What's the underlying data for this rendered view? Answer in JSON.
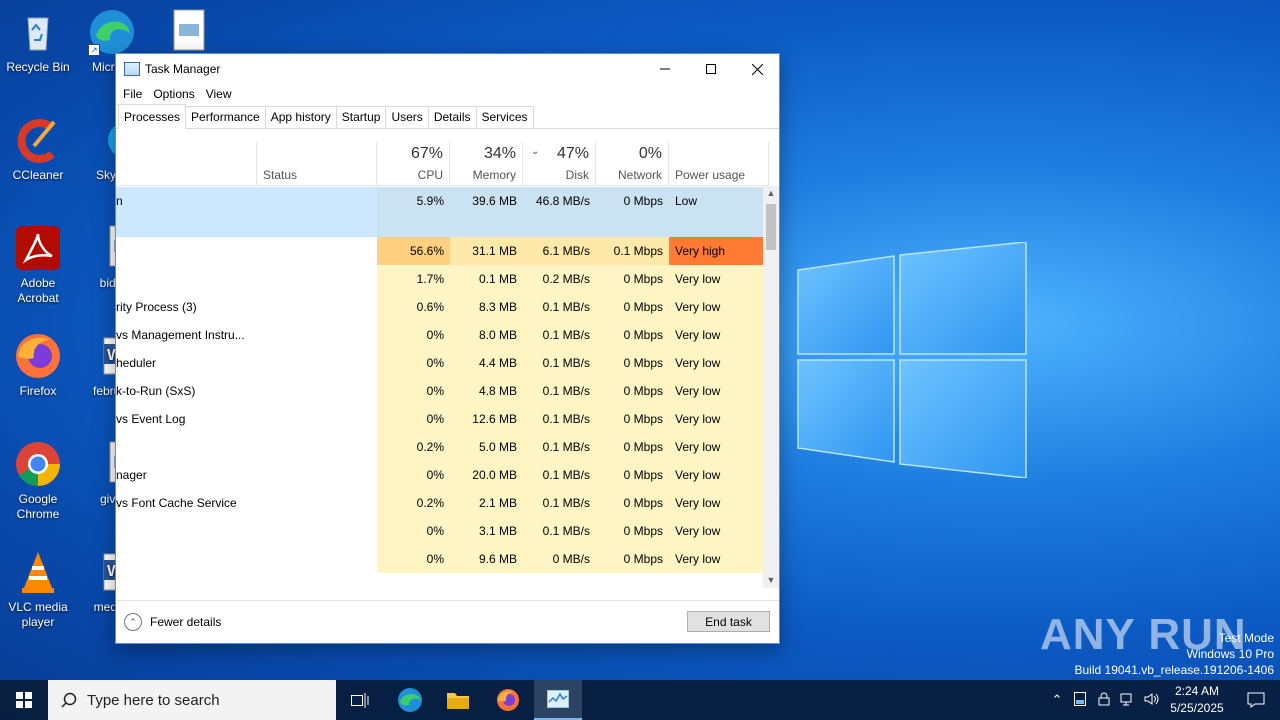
{
  "desktop": {
    "icons": [
      {
        "label": "Recycle Bin"
      },
      {
        "label": "Microsoft Edge"
      },
      {
        "label": "CCleaner"
      },
      {
        "label": "Skype"
      },
      {
        "label": "Adobe Acrobat"
      },
      {
        "label": "bidex"
      },
      {
        "label": "Firefox"
      },
      {
        "label": "februar"
      },
      {
        "label": "Google Chrome"
      },
      {
        "label": "givec"
      },
      {
        "label": "VLC media player"
      },
      {
        "label": "medire"
      }
    ]
  },
  "window": {
    "title": "Task Manager",
    "menu": [
      "File",
      "Options",
      "View"
    ],
    "tabs": [
      "Processes",
      "Performance",
      "App history",
      "Startup",
      "Users",
      "Details",
      "Services"
    ],
    "active_tab": "Processes"
  },
  "columns": {
    "status": {
      "label": "Status"
    },
    "cpu": {
      "pct": "67%",
      "label": "CPU"
    },
    "memory": {
      "pct": "34%",
      "label": "Memory"
    },
    "disk": {
      "pct": "47%",
      "label": "Disk"
    },
    "network": {
      "pct": "0%",
      "label": "Network"
    },
    "power": {
      "label": "Power usage"
    }
  },
  "rows": [
    {
      "name": "n",
      "cpu": "5.9%",
      "memory": "39.6 MB",
      "disk": "46.8 MB/s",
      "network": "0 Mbps",
      "power": "Low",
      "tall": true,
      "selected": true
    },
    {
      "name": "",
      "cpu": "56.6%",
      "memory": "31.1 MB",
      "disk": "6.1 MB/s",
      "network": "0.1 Mbps",
      "power": "Very high",
      "hot": true
    },
    {
      "name": "",
      "cpu": "1.7%",
      "memory": "0.1 MB",
      "disk": "0.2 MB/s",
      "network": "0 Mbps",
      "power": "Very low"
    },
    {
      "name": "rity Process (3)",
      "cpu": "0.6%",
      "memory": "8.3 MB",
      "disk": "0.1 MB/s",
      "network": "0 Mbps",
      "power": "Very low"
    },
    {
      "name": "vs Management Instru...",
      "cpu": "0%",
      "memory": "8.0 MB",
      "disk": "0.1 MB/s",
      "network": "0 Mbps",
      "power": "Very low"
    },
    {
      "name": "heduler",
      "cpu": "0%",
      "memory": "4.4 MB",
      "disk": "0.1 MB/s",
      "network": "0 Mbps",
      "power": "Very low"
    },
    {
      "name": "k-to-Run (SxS)",
      "cpu": "0%",
      "memory": "4.8 MB",
      "disk": "0.1 MB/s",
      "network": "0 Mbps",
      "power": "Very low"
    },
    {
      "name": "vs Event Log",
      "cpu": "0%",
      "memory": "12.6 MB",
      "disk": "0.1 MB/s",
      "network": "0 Mbps",
      "power": "Very low"
    },
    {
      "name": "",
      "cpu": "0.2%",
      "memory": "5.0 MB",
      "disk": "0.1 MB/s",
      "network": "0 Mbps",
      "power": "Very low"
    },
    {
      "name": "nager",
      "cpu": "0%",
      "memory": "20.0 MB",
      "disk": "0.1 MB/s",
      "network": "0 Mbps",
      "power": "Very low"
    },
    {
      "name": "vs Font Cache Service",
      "cpu": "0.2%",
      "memory": "2.1 MB",
      "disk": "0.1 MB/s",
      "network": "0 Mbps",
      "power": "Very low"
    },
    {
      "name": "",
      "cpu": "0%",
      "memory": "3.1 MB",
      "disk": "0.1 MB/s",
      "network": "0 Mbps",
      "power": "Very low"
    },
    {
      "name": "",
      "cpu": "0%",
      "memory": "9.6 MB",
      "disk": "0 MB/s",
      "network": "0 Mbps",
      "power": "Very low"
    }
  ],
  "footer": {
    "fewer_details": "Fewer details",
    "end_task": "End task"
  },
  "watermark": {
    "line1": "Test Mode",
    "line2": "Windows 10 Pro",
    "line3": "Build 19041.vb_release.191206-1406",
    "brand": "ANY RUN"
  },
  "taskbar": {
    "search_placeholder": "Type here to search",
    "time": "2:24 AM",
    "date": "5/25/2025"
  },
  "colors": {
    "heat_light": "#fff4c4",
    "heat_medium": "#ffe9a8",
    "heat_hot": "#ffd080",
    "power_very_high": "#ff7a33",
    "selected": "#cce8ff"
  }
}
